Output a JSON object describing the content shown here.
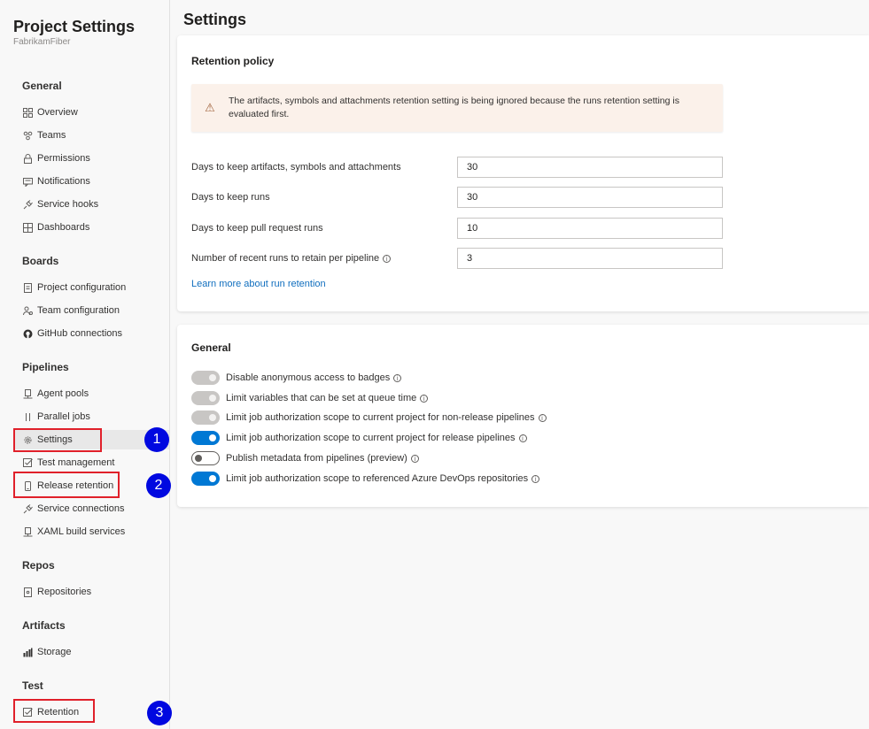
{
  "sidebar": {
    "title": "Project Settings",
    "subtitle": "FabrikamFiber",
    "sections": {
      "general": "General",
      "boards": "Boards",
      "pipelines": "Pipelines",
      "repos": "Repos",
      "artifacts": "Artifacts",
      "test": "Test"
    },
    "items": {
      "overview": "Overview",
      "teams": "Teams",
      "permissions": "Permissions",
      "notifications": "Notifications",
      "service_hooks": "Service hooks",
      "dashboards": "Dashboards",
      "project_configuration": "Project configuration",
      "team_configuration": "Team configuration",
      "github_connections": "GitHub connections",
      "agent_pools": "Agent pools",
      "parallel_jobs": "Parallel jobs",
      "settings": "Settings",
      "test_management": "Test management",
      "release_retention": "Release retention",
      "service_connections": "Service connections",
      "xaml_build_services": "XAML build services",
      "repositories": "Repositories",
      "storage": "Storage",
      "retention": "Retention"
    },
    "selected": "settings"
  },
  "callouts": [
    "1",
    "2",
    "3"
  ],
  "main": {
    "title": "Settings",
    "retention": {
      "title": "Retention policy",
      "warning": "The artifacts, symbols and attachments retention setting is being ignored because the runs retention setting is evaluated first.",
      "fields": [
        {
          "label": "Days to keep artifacts, symbols and attachments",
          "value": "30"
        },
        {
          "label": "Days to keep runs",
          "value": "30"
        },
        {
          "label": "Days to keep pull request runs",
          "value": "10"
        },
        {
          "label": "Number of recent runs to retain per pipeline",
          "value": "3"
        }
      ],
      "learn_more": "Learn more about run retention"
    },
    "general": {
      "title": "General",
      "toggles": [
        {
          "label": "Disable anonymous access to badges",
          "state": "on-disabled"
        },
        {
          "label": "Limit variables that can be set at queue time",
          "state": "on-disabled"
        },
        {
          "label": "Limit job authorization scope to current project for non-release pipelines",
          "state": "on-disabled"
        },
        {
          "label": "Limit job authorization scope to current project for release pipelines",
          "state": "on"
        },
        {
          "label": "Publish metadata from pipelines (preview)",
          "state": "off"
        },
        {
          "label": "Limit job authorization scope to referenced Azure DevOps repositories",
          "state": "on"
        }
      ]
    }
  },
  "colors": {
    "accent": "#0078d4",
    "callout_badge": "#0008e0",
    "callout_box": "#e0202a",
    "warning_bg": "#fbf1ea"
  }
}
